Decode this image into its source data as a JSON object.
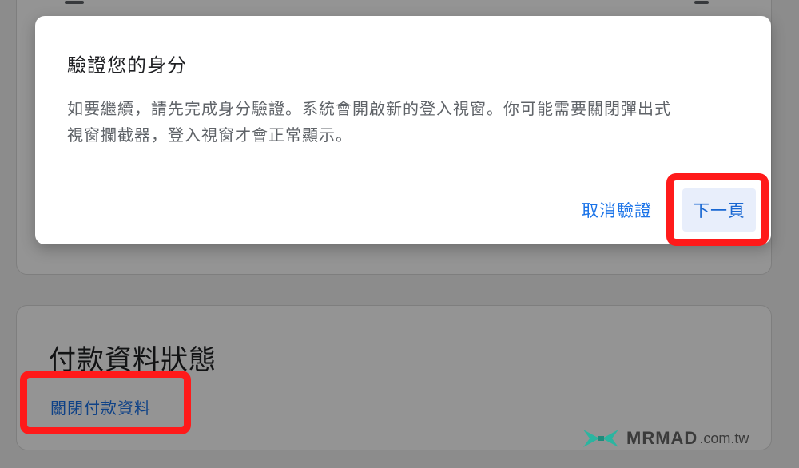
{
  "dialog": {
    "title": "驗證您的身分",
    "body_line1": "如要繼續，請先完成身分驗證。系統會開啟新的登入視窗。你可能需要關閉彈出式",
    "body_line2": "視窗攔截器，登入視窗才會正常顯示。",
    "cancel_label": "取消驗證",
    "next_label": "下一頁"
  },
  "payment_section": {
    "title": "付款資料狀態",
    "close_link": "關閉付款資料"
  },
  "watermark": {
    "brand": "MRMAD",
    "domain": ".com.tw"
  },
  "colors": {
    "accent": "#1a73e8",
    "highlight": "#ff1a1a",
    "logo": "#2bb5a0"
  }
}
